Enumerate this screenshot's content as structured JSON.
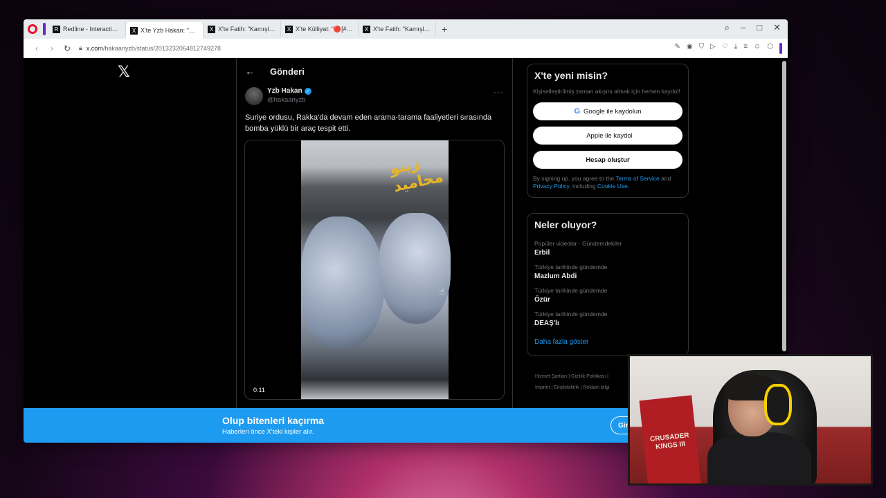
{
  "browser": {
    "tabs": [
      {
        "label": "Redline - Interactive Strate",
        "favicon": "R"
      },
      {
        "label": "X'te Yzb Hakan: \"Suriye or",
        "favicon": "X",
        "active": true
      },
      {
        "label": "X'te Fatih: \"Kamışlı'da topl",
        "favicon": "X"
      },
      {
        "label": "X'te Külliyat: \"🔴[#SONDA",
        "favicon": "X"
      },
      {
        "label": "X'te Fatih: \"Kamışlı'da topl",
        "favicon": "X"
      }
    ],
    "new_tab": "+",
    "url_host": "x.com",
    "url_path": "/hakaanyzb/status/2013232064812749278"
  },
  "post": {
    "header_title": "Gönderi",
    "author_name": "Yzb Hakan",
    "author_handle": "@hakaanyzb",
    "text": "Suriye ordusu, Rakka'da devam eden arama-tarama faaliyetleri sırasında bomba yüklü bir araç tespit etti.",
    "video_duration": "0:11",
    "video_watermark": "زينو محاميد"
  },
  "signup": {
    "title": "X'te yeni misin?",
    "subtitle": "Kişiselleştirilmiş zaman akışını almak için hemen kaydol!",
    "google_button": "Google ile kaydolun",
    "apple_button": "Apple ile kaydol",
    "create_button": "Hesap oluştur",
    "terms_prefix": "By signing up, you agree to the ",
    "terms_link": "Terms of Service",
    "terms_and": " and ",
    "privacy_link": "Privacy Policy",
    "terms_including": ", including ",
    "cookie_link": "Cookie Use."
  },
  "trends": {
    "title": "Neler oluyor?",
    "items": [
      {
        "meta": "Popüler videolar · Gündemdekiler",
        "name": "Erbil"
      },
      {
        "meta": "Türkiye tarihinde gündemde",
        "name": "Mazlum Abdi"
      },
      {
        "meta": "Türkiye tarihinde gündemde",
        "name": "Özür"
      },
      {
        "meta": "Türkiye tarihinde gündemde",
        "name": "DEAŞ'lı"
      }
    ],
    "show_more": "Daha fazla göster"
  },
  "footer": {
    "line1": "Hizmet Şartları  |  Gizlilik Politikası  |",
    "line2": "Imprint  |  Erişilebilirlik  |  Reklam bilgi"
  },
  "banner": {
    "title": "Olup bitenleri kaçırma",
    "subtitle": "Haberleri önce X'teki kişiler alır.",
    "login_button": "Giriş yap"
  },
  "webcam": {
    "flag_text": "CRUSADER KINGS III"
  }
}
